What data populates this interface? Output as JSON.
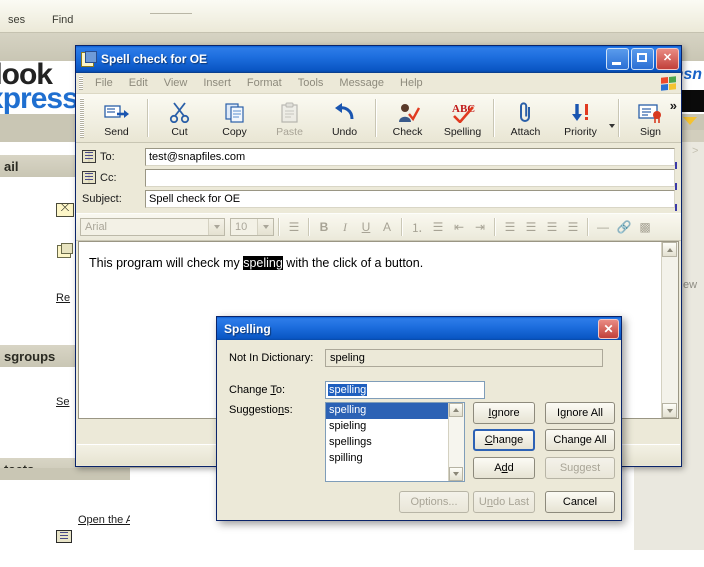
{
  "background": {
    "toolbar_items": [
      {
        "label": "ses"
      },
      {
        "label": "Find"
      }
    ],
    "brand_line1": "utlook",
    "brand_line2": "Express",
    "sections": [
      {
        "label": "ail"
      },
      {
        "label": "sgroups"
      },
      {
        "label": "tacts"
      }
    ],
    "links": [
      {
        "label": "Re"
      },
      {
        "label": "Se"
      },
      {
        "label": "Open the Address Book"
      }
    ],
    "msn_logo": "msn",
    "clipped_word": "ew"
  },
  "compose": {
    "title": "Spell check for OE",
    "window_buttons": {
      "minimize": "minimize-button",
      "maximize": "maximize-button",
      "close": "close-button"
    },
    "menu": [
      "File",
      "Edit",
      "View",
      "Insert",
      "Format",
      "Tools",
      "Message",
      "Help"
    ],
    "toolbar": [
      {
        "label": "Send",
        "icon": "send-icon",
        "disabled": false
      },
      {
        "label": "Cut",
        "icon": "cut-icon",
        "disabled": false
      },
      {
        "label": "Copy",
        "icon": "copy-icon",
        "disabled": false
      },
      {
        "label": "Paste",
        "icon": "paste-icon",
        "disabled": true
      },
      {
        "label": "Undo",
        "icon": "undo-icon",
        "disabled": false
      },
      {
        "label": "Check",
        "icon": "check-names-icon",
        "disabled": false
      },
      {
        "label": "Spelling",
        "icon": "spelling-abc-icon",
        "disabled": false
      },
      {
        "label": "Attach",
        "icon": "paperclip-icon",
        "disabled": false
      },
      {
        "label": "Priority",
        "icon": "priority-arrow-icon",
        "disabled": false
      },
      {
        "label": "Sign",
        "icon": "sign-certificate-icon",
        "disabled": false
      }
    ],
    "toolbar_overflow": "»",
    "fields": {
      "to_label": "To:",
      "to_value": "test@snapfiles.com",
      "cc_label": "Cc:",
      "cc_value": "",
      "subject_label": "Subject:",
      "subject_value": "Spell check for OE"
    },
    "format_bar": {
      "font_name": "Arial",
      "font_size": "10"
    },
    "body": {
      "before": "This program will check my ",
      "misspelled": "speling",
      "after": " with the click of a button."
    }
  },
  "spelling_dialog": {
    "title": "Spelling",
    "close_label": "✕",
    "not_in_dictionary_label": "Not In Dictionary:",
    "not_in_dictionary_value": "speling",
    "change_to_label_pre": "Change ",
    "change_to_label_key": "T",
    "change_to_label_post": "o:",
    "change_to_value": "spelling",
    "suggestions_label_pre": "Suggestio",
    "suggestions_label_key": "n",
    "suggestions_label_post": "s:",
    "suggestions": [
      "spelling",
      "spieling",
      "spellings",
      "spilling"
    ],
    "selected_suggestion_index": 0,
    "buttons": [
      {
        "pre": "",
        "key": "I",
        "post": "gnore",
        "state": "normal",
        "name": "ignore-button"
      },
      {
        "pre": "I",
        "key": "g",
        "post": "nore All",
        "state": "normal",
        "name": "ignore-all-button"
      },
      {
        "pre": "",
        "key": "C",
        "post": "hange",
        "state": "default",
        "name": "change-button"
      },
      {
        "pre": "Change All",
        "key": "",
        "post": "",
        "state": "normal",
        "name": "change-all-button"
      },
      {
        "pre": "A",
        "key": "d",
        "post": "d",
        "state": "normal",
        "name": "add-button"
      },
      {
        "pre": "Suggest",
        "key": "",
        "post": "",
        "state": "disabled",
        "name": "suggest-button"
      },
      {
        "pre": "Options...",
        "key": "",
        "post": "",
        "state": "disabled",
        "name": "options-button"
      },
      {
        "pre": "U",
        "key": "n",
        "post": "do Last",
        "state": "disabled",
        "name": "undo-last-button"
      },
      {
        "pre": "Cancel",
        "key": "",
        "post": "",
        "state": "normal",
        "name": "cancel-button"
      }
    ]
  },
  "colors": {
    "titlebar_blue": "#1e6fdf",
    "dialog_face": "#ece9d8",
    "selection_blue": "#2c62b5",
    "body_selection": "#000000",
    "brand_blue": "#1f6fd0"
  }
}
